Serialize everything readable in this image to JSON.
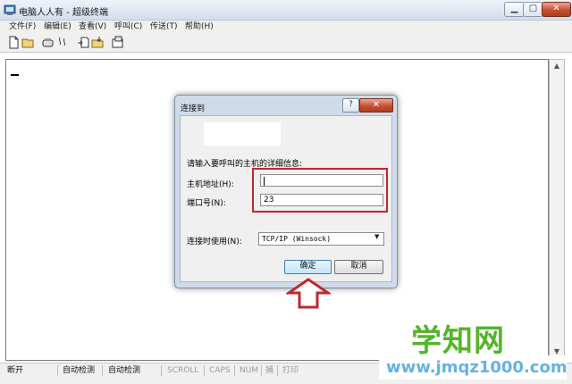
{
  "window": {
    "title": "电脑人人有 - 超级终端",
    "minimize_icon": "minimize-icon",
    "maximize_icon": "maximize-icon",
    "close_glyph": "✕"
  },
  "menu": {
    "items": [
      "文件(F)",
      "编辑(E)",
      "查看(V)",
      "呼叫(C)",
      "传送(T)",
      "帮助(H)"
    ]
  },
  "toolbar": {
    "icons": [
      "new-icon",
      "open-icon",
      "connect-icon",
      "disconnect-icon",
      "send-icon",
      "receive-icon",
      "properties-icon"
    ]
  },
  "terminal": {
    "cursor": "_"
  },
  "statusbar": {
    "items": [
      "断开",
      "自动检测",
      "自动检测",
      "SCROLL",
      "CAPS",
      "NUM",
      "捕",
      "打印"
    ]
  },
  "dialog": {
    "title": "连接到",
    "help_glyph": "?",
    "close_glyph": "✕",
    "prompt": "请输入要呼叫的主机的详细信息:",
    "host_label": "主机地址(H):",
    "host_value": "",
    "port_label": "端口号(N):",
    "port_value": "23",
    "using_label": "连接时使用(N):",
    "using_value": "TCP/IP (Winsock)",
    "ok_label": "确定",
    "cancel_label": "取消"
  },
  "annotation": {
    "highlight_color": "#c2272d"
  },
  "watermark": {
    "text": "学知网",
    "url": "www.jmqz1000.com"
  }
}
